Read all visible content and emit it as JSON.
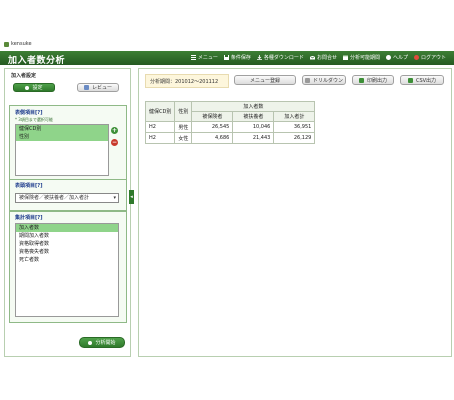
{
  "topbar": {
    "app_name": "kensuke"
  },
  "header": {
    "title": "加入者数分析",
    "nav": [
      {
        "label": "メニュー",
        "icon": "menu-icon"
      },
      {
        "label": "条件保存",
        "icon": "save-icon"
      },
      {
        "label": "各種ダウンロード",
        "icon": "download-icon"
      },
      {
        "label": "お問合せ",
        "icon": "mail-icon"
      },
      {
        "label": "分析可能期間",
        "icon": "calendar-icon"
      },
      {
        "label": "ヘルプ",
        "icon": "help-icon"
      },
      {
        "label": "ログアウト",
        "icon": "logout-icon"
      }
    ]
  },
  "left": {
    "settings_title": "加入者設定",
    "settings_button": "設定",
    "review_button": "レビュー",
    "display_items_title": "表側項目",
    "display_items_help": "[?]",
    "display_items_note": "* 3項目まで選択可能",
    "display_items_list": [
      "健保CD別",
      "性別"
    ],
    "header_items_title": "表頭項目",
    "header_items_help": "[?]",
    "header_items_select": "被保険者／被扶養者／加入者計",
    "aggregate_title": "集計項目",
    "aggregate_help": "[?]",
    "aggregate_list": [
      "加入者数",
      "期間加入者数",
      "資格取得者数",
      "資格喪失者数",
      "死亡者数"
    ],
    "run_button": "分析開始"
  },
  "right": {
    "period_label": "分析期間：201012～201112",
    "toolbar": [
      {
        "label": "メニュー登録",
        "icon": ""
      },
      {
        "label": "ドリルダウン",
        "icon": "drilldown-icon"
      },
      {
        "label": "印刷出力",
        "icon": "print-icon"
      },
      {
        "label": "CSV出力",
        "icon": "csv-icon"
      }
    ],
    "table": {
      "col_kenpo": "健保CD別",
      "col_sex": "性別",
      "group_header": "加入者数",
      "sub_headers": [
        "被保険者",
        "被扶養者",
        "加入者計"
      ],
      "rows": [
        {
          "kenpo": "H2",
          "sex": "男性",
          "insured": "26,545",
          "dependent": "10,046",
          "total": "36,951"
        },
        {
          "kenpo": "H2",
          "sex": "女性",
          "insured": "4,686",
          "dependent": "21,443",
          "total": "26,129"
        }
      ]
    }
  },
  "colors": {
    "header_green": "#2e6b2a",
    "selected_row": "#8fd48a",
    "period_bg": "#fdf6dc"
  }
}
